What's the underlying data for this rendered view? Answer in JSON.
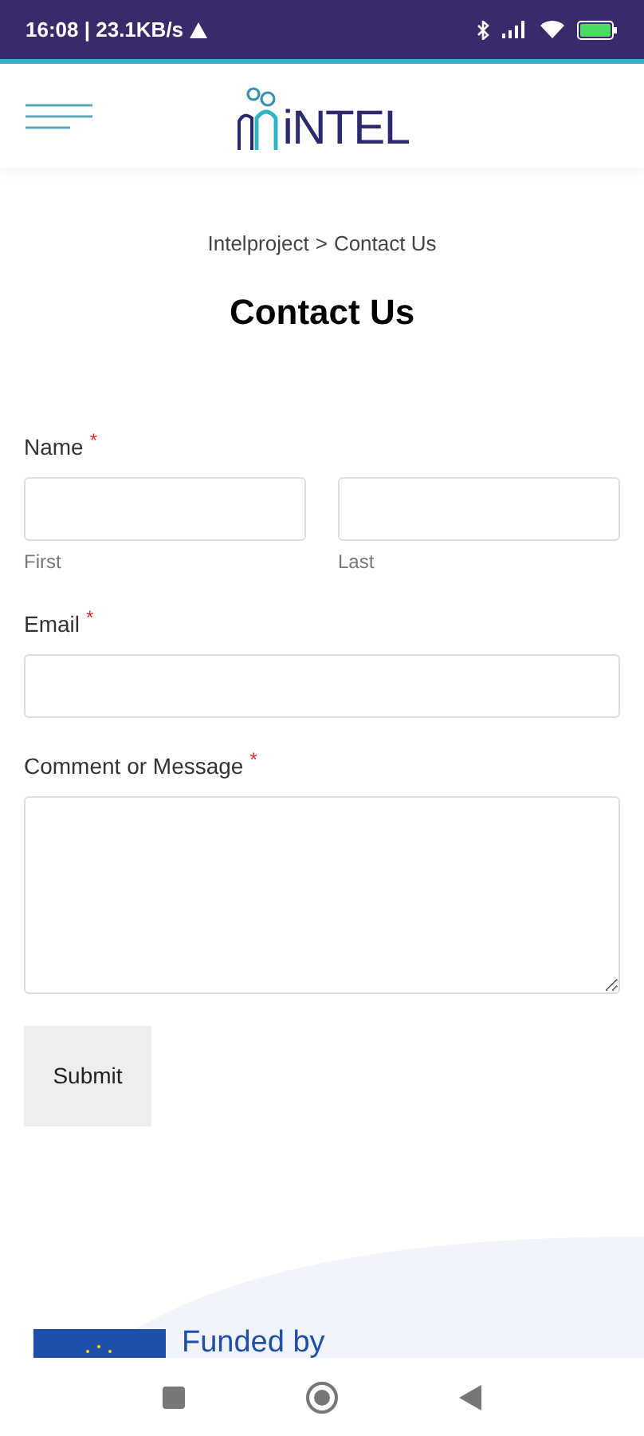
{
  "status_bar": {
    "time": "16:08 | 23.1KB/s"
  },
  "header": {
    "logo_text": "iNTEL"
  },
  "breadcrumb": {
    "parent": "Intelproject",
    "separator": ">",
    "current": "Contact Us"
  },
  "title": "Contact Us",
  "form": {
    "fields": [
      {
        "kind": "name",
        "label": "Name",
        "required_mark": "*",
        "parts": [
          {
            "sublabel": "First"
          },
          {
            "sublabel": "Last"
          }
        ]
      },
      {
        "kind": "text",
        "label": "Email",
        "required_mark": "*"
      },
      {
        "kind": "textarea",
        "label": "Comment or Message",
        "required_mark": "*"
      }
    ],
    "submit": "Submit"
  },
  "footer": {
    "funded_text": "Funded by"
  }
}
